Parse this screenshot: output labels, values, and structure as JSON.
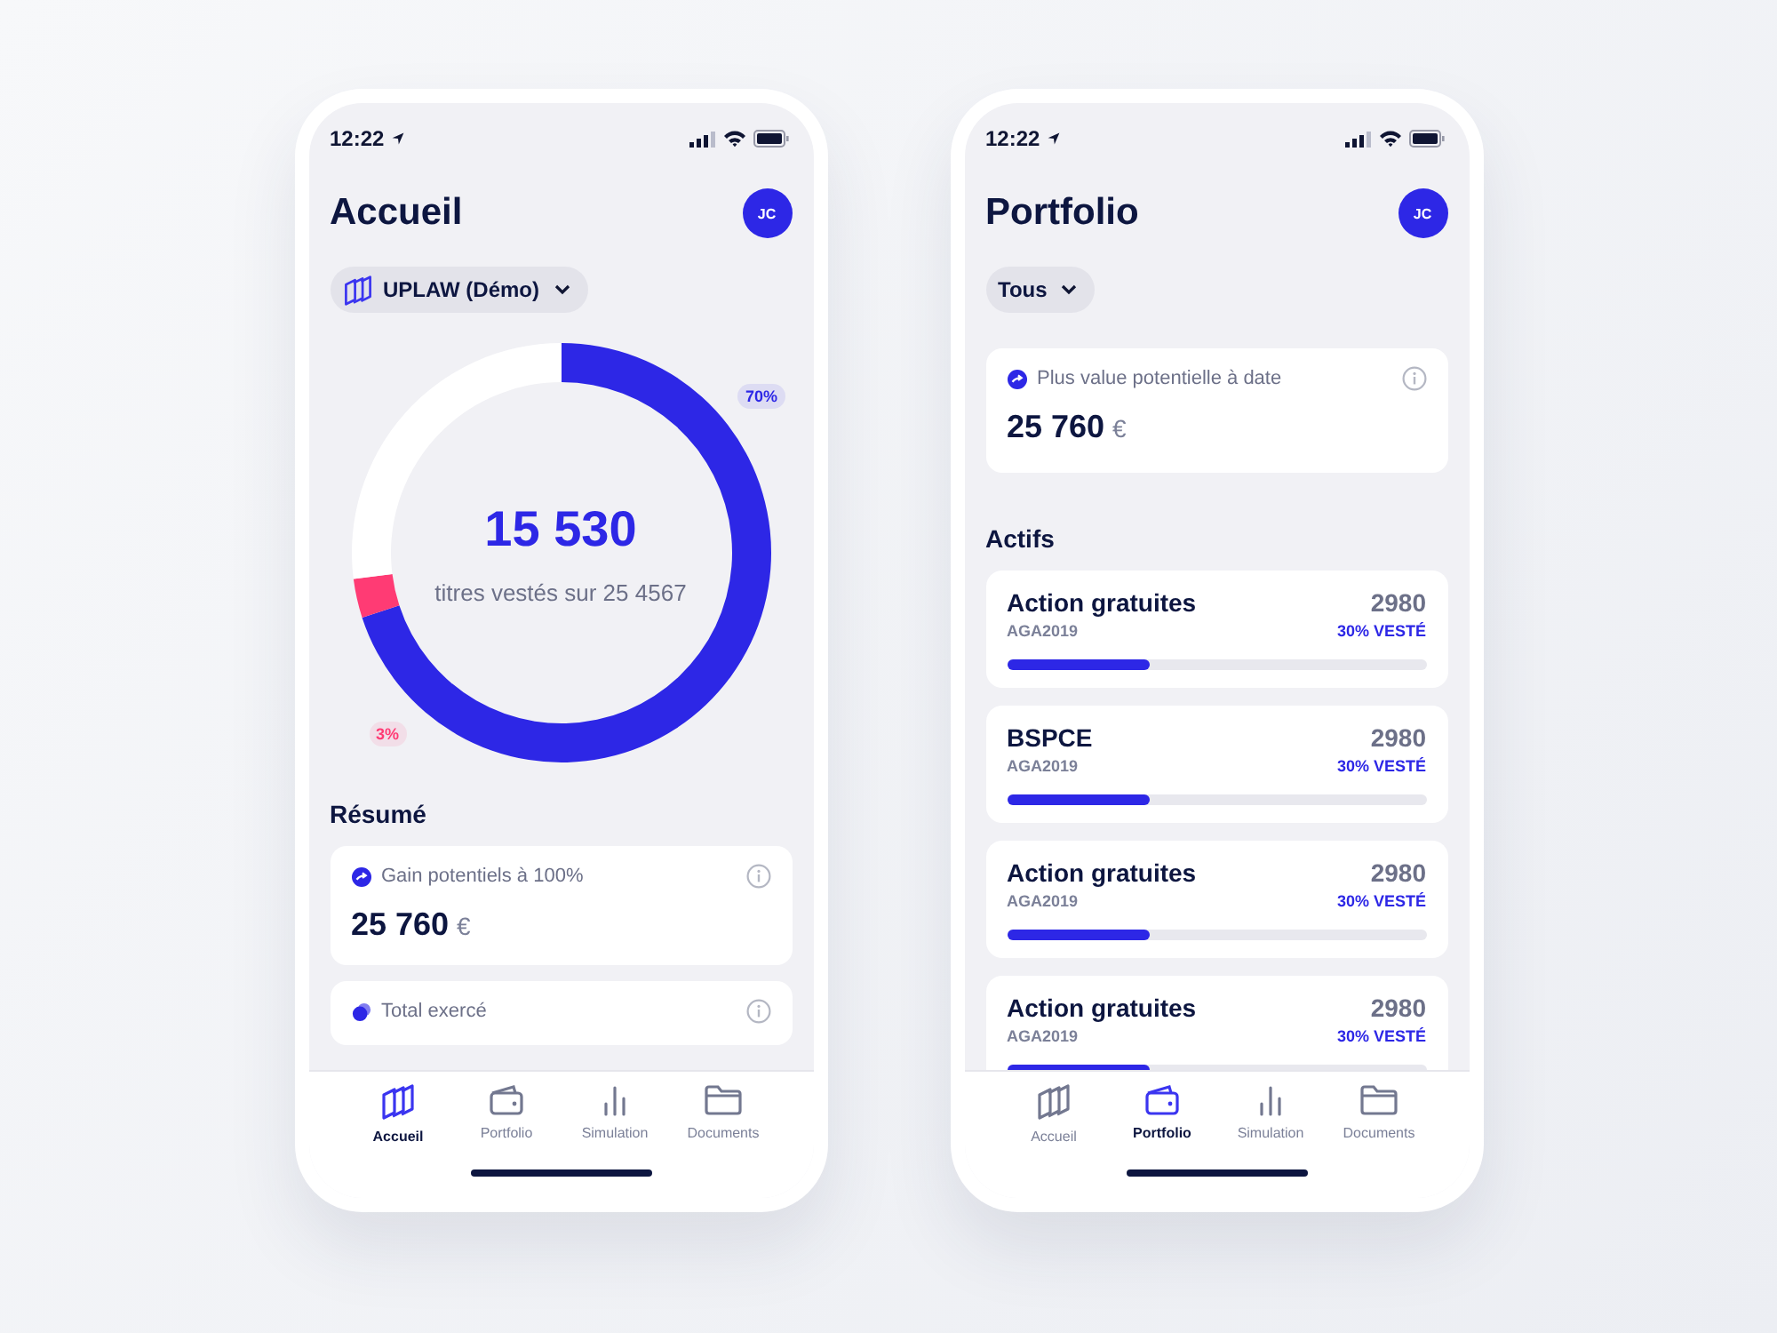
{
  "screens": [
    {
      "kind": "home",
      "time": "12:22",
      "title": "Accueil",
      "avatar": "JC",
      "filter": "UPLAW (Démo)",
      "ring": {
        "value": "15 530",
        "caption": "titres vestés sur 25 4567",
        "chart_data": {
          "type": "donut",
          "values": [
            70,
            3,
            27
          ],
          "value_labels": [
            "70%",
            "3%",
            null
          ]
        }
      },
      "section": "Résumé",
      "cards": [
        {
          "label": "Gain potentiels à 100%",
          "value": "25 760",
          "currency": "€"
        },
        {
          "label": "Total exercé"
        }
      ],
      "tabs": [
        {
          "label": "Accueil",
          "selected": true
        },
        {
          "label": "Portfolio",
          "selected": false
        },
        {
          "label": "Simulation",
          "selected": false
        },
        {
          "label": "Documents",
          "selected": false
        }
      ]
    },
    {
      "kind": "portfolio",
      "time": "12:22",
      "title": "Portfolio",
      "avatar": "JC",
      "filter": "Tous",
      "summary": {
        "label": "Plus value potentielle à date",
        "value": "25 760",
        "currency": "€"
      },
      "section": "Actifs",
      "assets": [
        {
          "name": "Action gratuites",
          "code": "AGA2019",
          "count": "2980",
          "vested": "30% VESTÉ",
          "level": 0.34
        },
        {
          "name": "BSPCE",
          "code": "AGA2019",
          "count": "2980",
          "vested": "30% VESTÉ",
          "level": 0.34
        },
        {
          "name": "Action gratuites",
          "code": "AGA2019",
          "count": "2980",
          "vested": "30% VESTÉ",
          "level": 0.34
        },
        {
          "name": "Action gratuites",
          "code": "AGA2019",
          "count": "2980",
          "vested": "30% VESTÉ",
          "level": 0.34
        }
      ],
      "tabs": [
        {
          "label": "Accueil",
          "selected": false
        },
        {
          "label": "Portfolio",
          "selected": true
        },
        {
          "label": "Simulation",
          "selected": false
        },
        {
          "label": "Documents",
          "selected": false
        }
      ]
    }
  ]
}
